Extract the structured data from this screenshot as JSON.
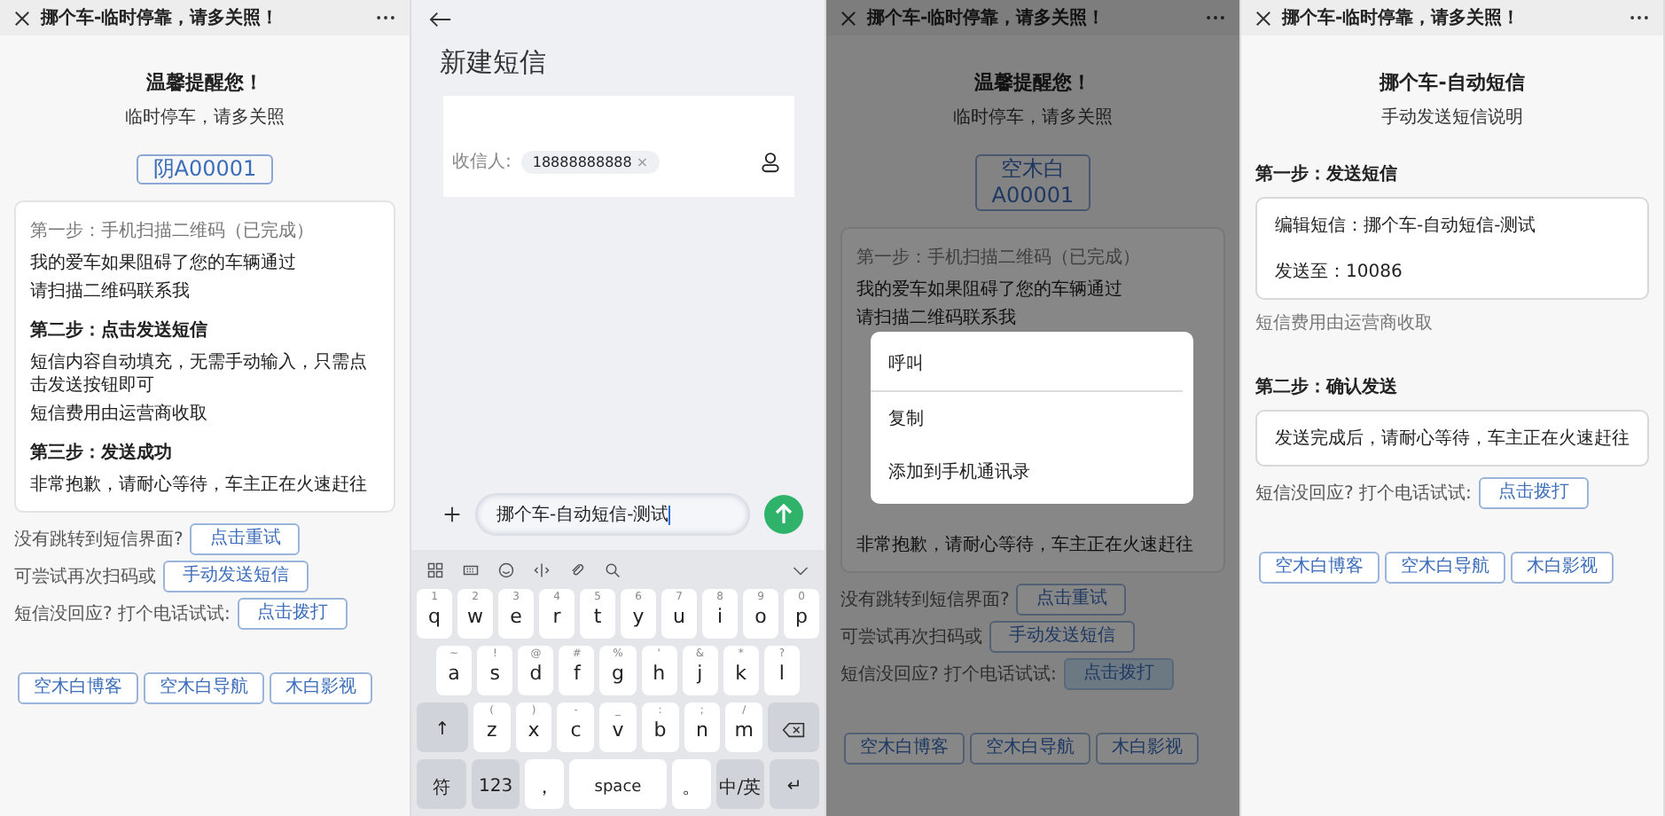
{
  "screens": [
    {
      "kind": "guide",
      "title": "挪个车-临时停靠，请多关照！",
      "heading": "温馨提醒您！",
      "subtitle": "临时停车，请多关照",
      "plate_lines": [
        "阴A00001"
      ],
      "card_lines": [
        {
          "kind": "muted",
          "text": "第一步：手机扫描二维码（已完成）"
        },
        {
          "kind": "text",
          "text": "我的爱车如果阻碍了您的车辆通过"
        },
        {
          "kind": "text",
          "text": "请扫描二维码联系我"
        },
        {
          "kind": "heading",
          "text": "第二步：点击发送短信"
        },
        {
          "kind": "text",
          "text": "短信内容自动填充，无需手动输入，只需点击发送按钮即可"
        },
        {
          "kind": "text",
          "text": "短信费用由运营商收取"
        },
        {
          "kind": "heading",
          "text": "第三步：发送成功"
        },
        {
          "kind": "text",
          "text": "非常抱歉，请耐心等待，车主正在火速赶往"
        }
      ],
      "help_rows": [
        {
          "label": "没有跳转到短信界面?",
          "button": "点击重试",
          "pressed": false
        },
        {
          "label": "可尝试再次扫码或",
          "button": "手动发送短信",
          "pressed": false
        },
        {
          "label": "短信没回应? 打个电话试试:",
          "button": "点击拨打",
          "pressed": false
        }
      ],
      "links": [
        "空木白博客",
        "空木白导航",
        "木白影视"
      ]
    },
    {
      "kind": "sms",
      "title": "新建短信",
      "recipient_label": "收信人:",
      "recipient": "18888888888",
      "chip_remove": "×",
      "message": "挪个车-自动短信-测试",
      "keyboard": [
        [
          {
            "kind": "letter",
            "label": "q",
            "hint": "1"
          },
          {
            "kind": "letter",
            "label": "w",
            "hint": "2"
          },
          {
            "kind": "letter",
            "label": "e",
            "hint": "3"
          },
          {
            "kind": "letter",
            "label": "r",
            "hint": "4"
          },
          {
            "kind": "letter",
            "label": "t",
            "hint": "5"
          },
          {
            "kind": "letter",
            "label": "y",
            "hint": "6"
          },
          {
            "kind": "letter",
            "label": "u",
            "hint": "7"
          },
          {
            "kind": "letter",
            "label": "i",
            "hint": "8"
          },
          {
            "kind": "letter",
            "label": "o",
            "hint": "9"
          },
          {
            "kind": "letter",
            "label": "p",
            "hint": "0"
          }
        ],
        [
          {
            "kind": "letter",
            "label": "a",
            "hint": "~"
          },
          {
            "kind": "letter",
            "label": "s",
            "hint": "!"
          },
          {
            "kind": "letter",
            "label": "d",
            "hint": "@"
          },
          {
            "kind": "letter",
            "label": "f",
            "hint": "#"
          },
          {
            "kind": "letter",
            "label": "g",
            "hint": "%"
          },
          {
            "kind": "letter",
            "label": "h",
            "hint": "'"
          },
          {
            "kind": "letter",
            "label": "j",
            "hint": "&"
          },
          {
            "kind": "letter",
            "label": "k",
            "hint": "*"
          },
          {
            "kind": "letter",
            "label": "l",
            "hint": "?"
          }
        ],
        [
          {
            "kind": "func",
            "label": "↑"
          },
          {
            "kind": "letter",
            "label": "z",
            "hint": "("
          },
          {
            "kind": "letter",
            "label": "x",
            "hint": ")"
          },
          {
            "kind": "letter",
            "label": "c",
            "hint": "-"
          },
          {
            "kind": "letter",
            "label": "v",
            "hint": "_"
          },
          {
            "kind": "letter",
            "label": "b",
            "hint": ":"
          },
          {
            "kind": "letter",
            "label": "n",
            "hint": ";"
          },
          {
            "kind": "letter",
            "label": "m",
            "hint": "/"
          },
          {
            "kind": "delete"
          }
        ],
        [
          {
            "kind": "func",
            "label": "符"
          },
          {
            "kind": "func",
            "label": "123"
          },
          {
            "kind": "letter",
            "label": "，"
          },
          {
            "kind": "space",
            "label": "space"
          },
          {
            "kind": "letter",
            "label": "。"
          },
          {
            "kind": "func",
            "label": "中/英"
          },
          {
            "kind": "func",
            "label": "↵"
          }
        ]
      ]
    },
    {
      "kind": "guide",
      "title": "挪个车-临时停靠，请多关照！",
      "heading": "温馨提醒您！",
      "subtitle": "临时停车，请多关照",
      "plate_lines": [
        "空木白",
        "A00001"
      ],
      "card_lines": [
        {
          "kind": "muted",
          "text": "第一步：手机扫描二维码（已完成）"
        },
        {
          "kind": "text",
          "text": "我的爱车如果阻碍了您的车辆通过"
        },
        {
          "kind": "text",
          "text": "请扫描二维码联系我"
        },
        {
          "kind": "text",
          "text": "非常抱歉，请耐心等待，车主正在火速赶往"
        }
      ],
      "help_rows": [
        {
          "label": "没有跳转到短信界面?",
          "button": "点击重试",
          "pressed": false
        },
        {
          "label": "可尝试再次扫码或",
          "button": "手动发送短信",
          "pressed": false
        },
        {
          "label": "短信没回应? 打个电话试试:",
          "button": "点击拨打",
          "pressed": true
        }
      ],
      "links": [
        "空木白博客",
        "空木白导航",
        "木白影视"
      ],
      "context_menu": [
        "呼叫",
        "复制",
        "添加到手机通讯录"
      ]
    },
    {
      "kind": "manual",
      "title": "挪个车-临时停靠，请多关照！",
      "heading": "挪个车-自动短信",
      "subtitle": "手动发送短信说明",
      "step1": "第一步：发送短信",
      "sms_lines": [
        "编辑短信：挪个车-自动短信-测试",
        "发送至：10086"
      ],
      "note": "短信费用由运营商收取",
      "step2": "第二步：确认发送",
      "step2_text": "发送完成后，请耐心等待，车主正在火速赶往",
      "help_rows": [
        {
          "label": "短信没回应? 打个电话试试:",
          "button": "点击拨打",
          "pressed": false
        }
      ],
      "links": [
        "空木白博客",
        "空木白导航",
        "木白影视"
      ]
    }
  ]
}
